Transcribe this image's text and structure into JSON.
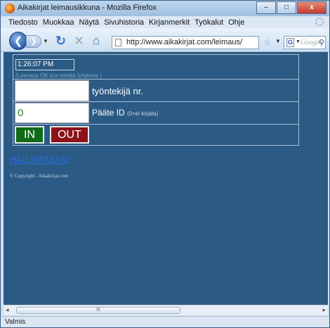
{
  "window": {
    "title": "Aikakirjat leimausikkuna - Mozilla Firefox",
    "controls": {
      "minimize": "–",
      "maximize": "□",
      "close": "x"
    }
  },
  "menu": [
    "Tiedosto",
    "Muokkaa",
    "Näytä",
    "Sivuhistoria",
    "Kirjanmerkit",
    "Työkalut",
    "Ohje"
  ],
  "navbar": {
    "url": "http://www.aikakirjat.com/leimaus/",
    "search_placeholder": "Google",
    "search_engine": "G"
  },
  "form": {
    "time": "1:26:07 PM",
    "hint": "(Leimaus OK kun kenttä tyhjenee )",
    "employee_value": "",
    "employee_label": "työntekijä nr.",
    "terminal_value": "0",
    "terminal_label": "Pääte ID",
    "terminal_note": "(0=ei kirjata)",
    "in_label": "IN",
    "out_label": "OUT"
  },
  "links": {
    "admin": "HALLINTASIVU",
    "copyright": "© Copyright - Aikakirjat.com"
  },
  "scrollbar": {
    "thumb_grip": "III",
    "left": "◂",
    "right": "▸"
  },
  "status": "Valmis",
  "colors": {
    "page_bg": "#2b5a84",
    "in_button": "#0f6b17",
    "out_button": "#8a1218",
    "link": "#2a6ee8"
  }
}
